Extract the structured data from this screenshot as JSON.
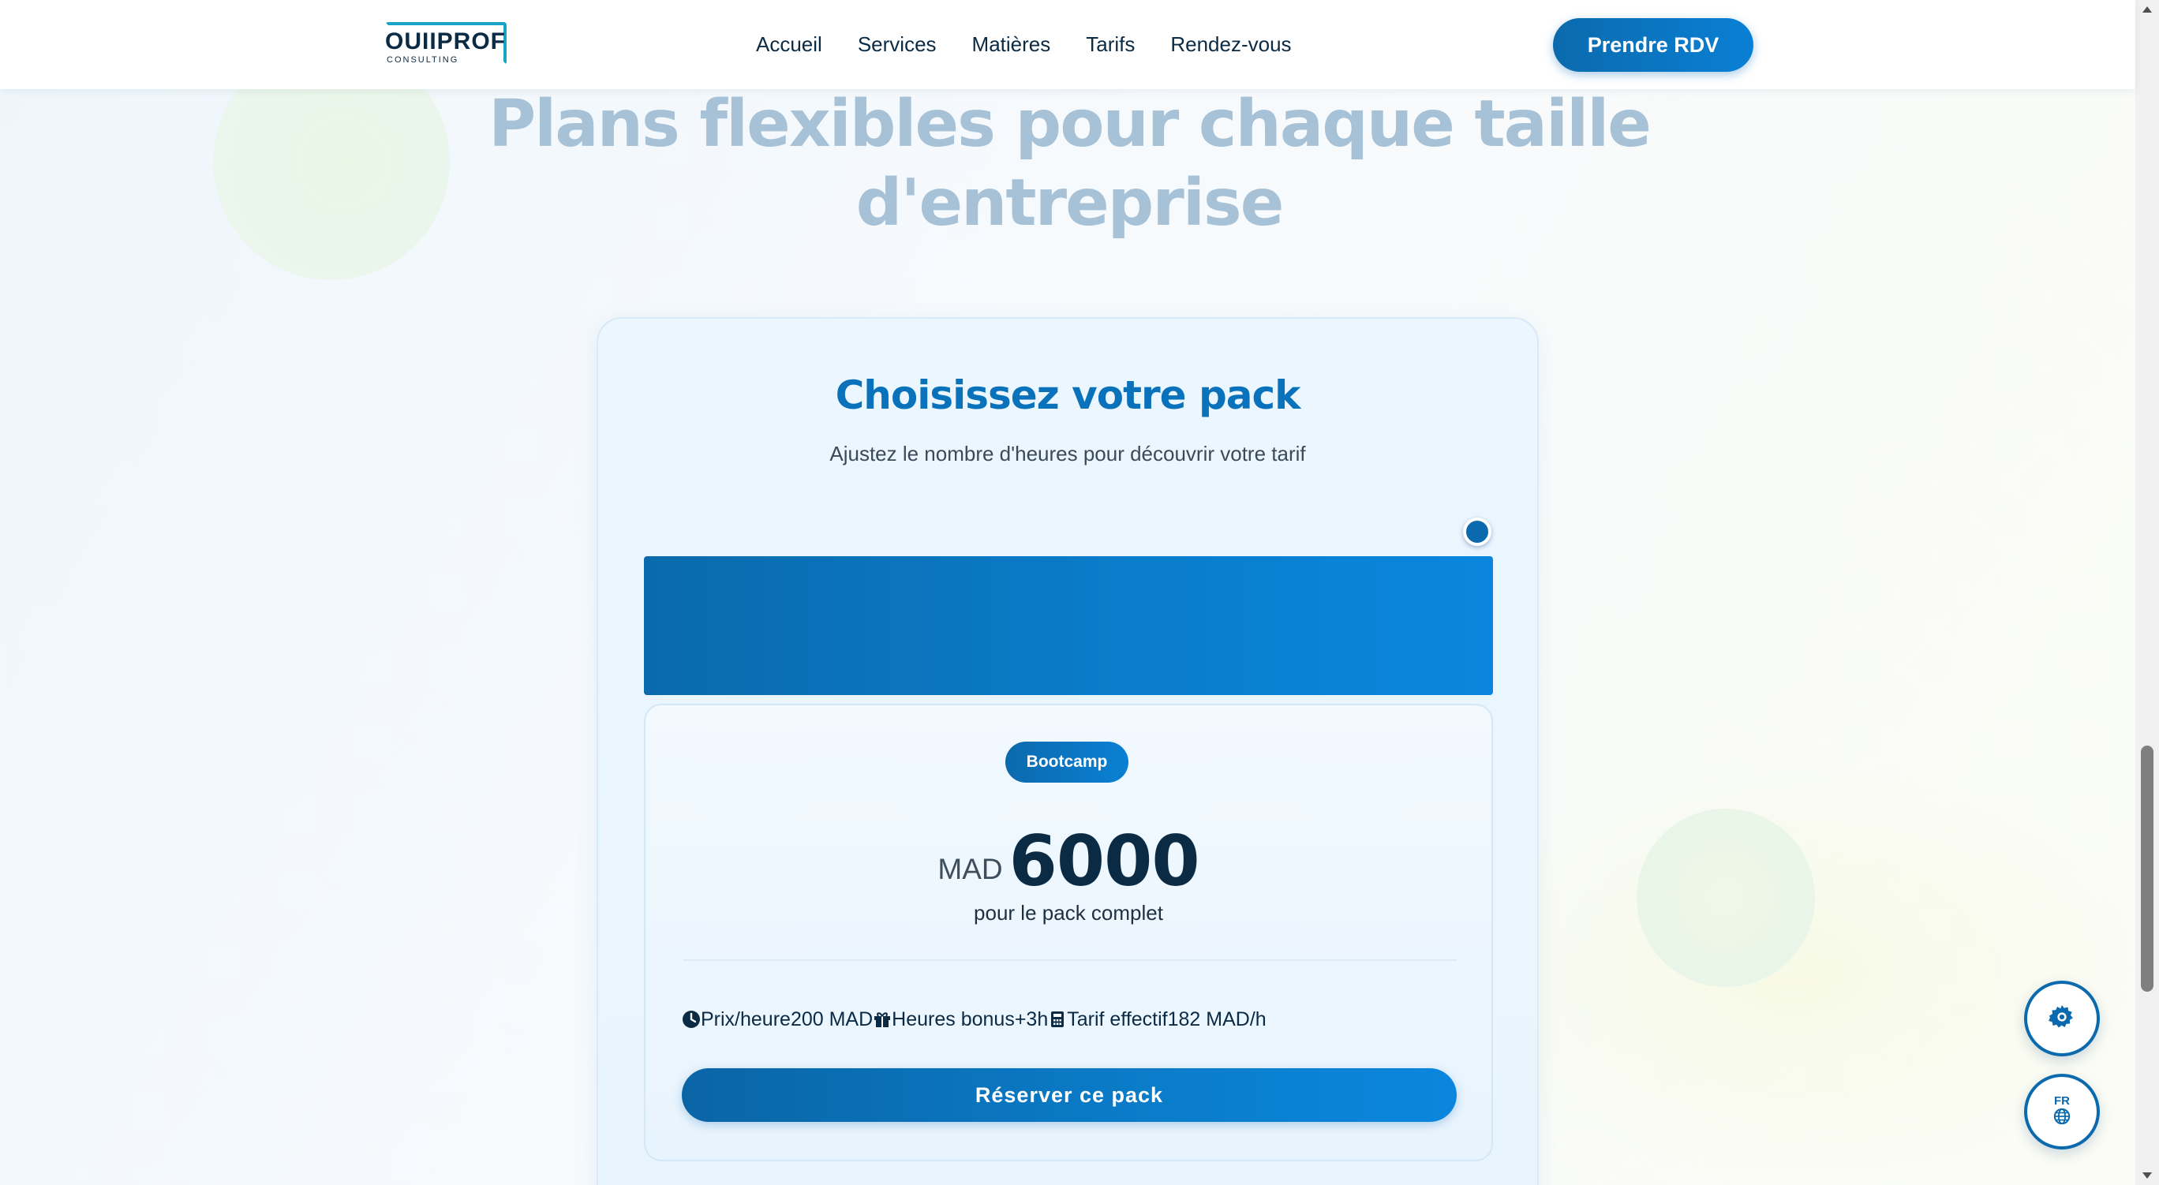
{
  "header": {
    "logo_text": "OUIIPROF",
    "logo_sub": "CONSULTING",
    "nav": [
      "Accueil",
      "Services",
      "Matières",
      "Tarifs",
      "Rendez-vous"
    ],
    "cta_label": "Prendre RDV"
  },
  "hero": {
    "headline": "Plans flexibles pour chaque taille d'entreprise"
  },
  "pack": {
    "title": "Choisissez votre pack",
    "subtitle": "Ajustez le nombre d'heures pour découvrir votre tarif",
    "slider_position": 1.0,
    "badge": "Bootcamp",
    "currency": "MAD",
    "amount": "6000",
    "price_note": "pour le pack complet",
    "stats": {
      "hourly_label": "Prix/heure",
      "hourly_value": "200 MAD",
      "bonus_label": "Heures bonus",
      "bonus_value": "+3h",
      "effective_label": "Tarif effectif",
      "effective_value": "182 MAD/h"
    },
    "book_label": "Réserver ce pack"
  },
  "floating": {
    "lang_label": "FR"
  },
  "colors": {
    "primary": "#0b6aad",
    "primary_light": "#0a86de",
    "heading_faded": "#a7c2d6",
    "text_dark": "#0b2a44"
  }
}
